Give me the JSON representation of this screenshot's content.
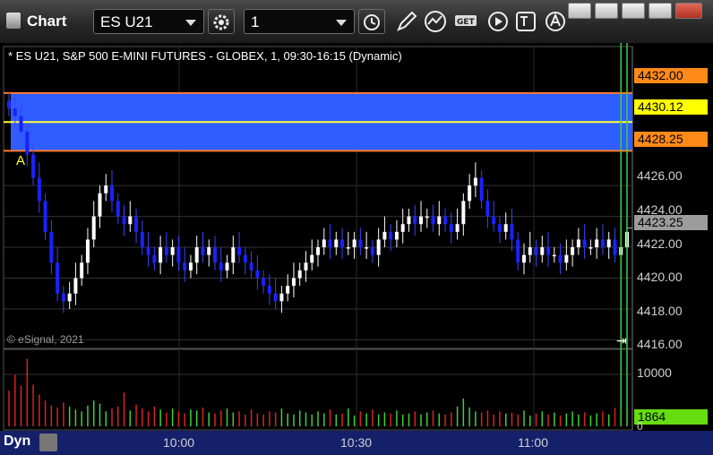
{
  "window": {
    "title": "Chart",
    "symbol_value": "ES U21",
    "interval_value": "1"
  },
  "header": {
    "description": "* ES U21, S&P 500 E-MINI FUTURES - GLOBEX, 1, 09:30-16:15 (Dynamic)"
  },
  "footer": {
    "copyright": "© eSignal, 2021",
    "mode_label": "Dyn"
  },
  "price_labels": {
    "upper": "4432.00",
    "mid": "4430.12",
    "lower": "4428.25",
    "last": "4423.25"
  },
  "volume_labels": {
    "tick": "10000",
    "current": "1864",
    "zero": "0"
  },
  "colors": {
    "band_fill": "#2f5dff",
    "band_border": "#ff7a2a",
    "mid_line": "#ffff33",
    "up_candle": "#ffffff",
    "down_candle": "#1a22ff",
    "vol_up": "#3bd13b",
    "vol_down": "#d8231e",
    "current_vol_label": "#66dd11"
  },
  "icons": [
    "gear-icon",
    "clock-icon",
    "pencil-icon",
    "study-icon",
    "get-icon",
    "play-icon",
    "text-tool-icon",
    "alert-icon"
  ],
  "chart_data": [
    {
      "type": "candlestick",
      "annotations": [
        "A"
      ],
      "y_axis": {
        "ticks": [
          "4426.00",
          "4424.00",
          "4422.00",
          "4420.00",
          "4418.00",
          "4416.00"
        ],
        "range": [
          4415.5,
          4433.5
        ]
      },
      "x_axis": {
        "ticks": [
          "10:00",
          "10:30",
          "11:00"
        ]
      },
      "band": {
        "upper": 4432.0,
        "mid": 4430.12,
        "lower": 4428.25
      },
      "last_price": 4423.25,
      "series": [
        {
          "values": [
            4431,
            4430.5,
            4429.5,
            4428,
            4426.5,
            4425,
            4423,
            4421,
            4419,
            4418.5,
            4419,
            4420,
            4421,
            4422.5,
            4424,
            4425.5,
            4426,
            4425,
            4424,
            4423.5,
            4424,
            4423,
            4422,
            4421.5,
            4421,
            4422,
            4421.5,
            4422,
            4421,
            4420.5,
            4421,
            4422,
            4421.5,
            4422,
            4421,
            4420.5,
            4421,
            4422,
            4421.5,
            4421,
            4420.5,
            4420,
            4419.5,
            4419,
            4418.5,
            4419,
            4419.5,
            4420,
            4420.5,
            4421,
            4421.5,
            4422,
            4422.5,
            4422,
            4422.5,
            4422,
            4422,
            4422.5,
            4422,
            4422,
            4421.5,
            4422.5,
            4423,
            4422.5,
            4423,
            4423.5,
            4424,
            4423.5,
            4424,
            4424,
            4423.5,
            4424,
            4423.5,
            4423,
            4423.5,
            4425,
            4426,
            4426.5,
            4425,
            4424,
            4423.5,
            4423,
            4423.5,
            4422.5,
            4421,
            4421.5,
            4422,
            4421.5,
            4422,
            4421.5,
            4421.5,
            4421,
            4421.5,
            4422,
            4422.5,
            4422,
            4422,
            4422.5,
            4422,
            4422.5,
            4421.5,
            4422,
            4423
          ]
        },
        {
          "name_hint": "volume",
          "values": [
            3600,
            5200,
            4100,
            6800,
            4200,
            3200,
            2600,
            2100,
            1900,
            2400,
            2000,
            1700,
            1500,
            2100,
            2600,
            2300,
            1500,
            1800,
            2000,
            3400,
            1600,
            2200,
            1800,
            1500,
            2000,
            1700,
            1400,
            1800,
            1500,
            1300,
            1700,
            1600,
            1900,
            1400,
            1300,
            1600,
            1800,
            1400,
            1500,
            1200,
            1700,
            1300,
            1200,
            1500,
            1400,
            1800,
            1300,
            1200,
            1600,
            1400,
            1200,
            1500,
            1300,
            1700,
            1200,
            1300,
            1800,
            1100,
            1500,
            1300,
            1700,
            1200,
            1400,
            1300,
            1600,
            1200,
            1300,
            1500,
            1200,
            1400,
            1600,
            1300,
            1200,
            1400,
            2000,
            2800,
            1900,
            1500,
            1400,
            1600,
            1200,
            1500,
            1300,
            1400,
            1200,
            1600,
            1100,
            1300,
            1500,
            1200,
            1400,
            1100,
            1300,
            1500,
            1200,
            1400,
            1100,
            1300,
            1500,
            1200,
            1864
          ]
        }
      ]
    }
  ]
}
